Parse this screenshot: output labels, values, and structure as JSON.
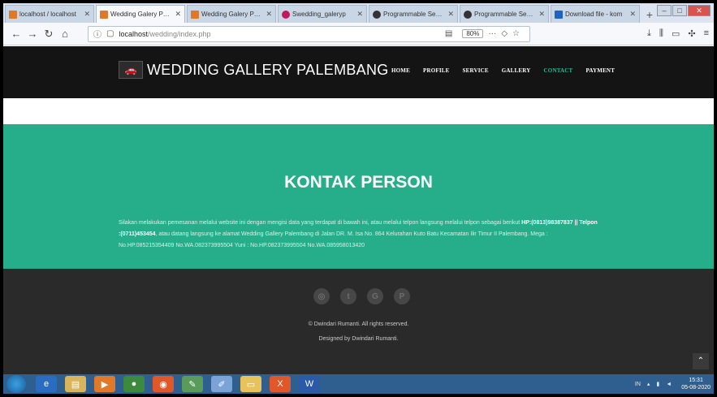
{
  "browser": {
    "tabs": [
      {
        "label": "localhost / localhost",
        "color": "#e0782a",
        "active": false
      },
      {
        "label": "Wedding Galery Palembang",
        "color": "#e0782a",
        "active": true
      },
      {
        "label": "Wedding Galery Palembang",
        "color": "#e0782a",
        "active": false
      },
      {
        "label": "Swedding_galeryp",
        "color": "#c2185b",
        "active": false
      },
      {
        "label": "Programmable Search",
        "color": "#333333",
        "active": false
      },
      {
        "label": "Programmable Search",
        "color": "#333333",
        "active": false
      },
      {
        "label": "Download file - kom",
        "color": "#1e63c4",
        "active": false
      }
    ],
    "url_host": "localhost",
    "url_path": "/wedding/index.php",
    "zoom": "80%"
  },
  "site": {
    "brand": "WEDDING GALLERY PALEMBANG",
    "menu": [
      {
        "label": "HOME",
        "active": false
      },
      {
        "label": "PROFILE",
        "active": false
      },
      {
        "label": "SERVICE",
        "active": false
      },
      {
        "label": "GALLERY",
        "active": false
      },
      {
        "label": "CONTACT",
        "active": true
      },
      {
        "label": "PAYMENT",
        "active": false
      }
    ],
    "accent": "#26ad8a",
    "contact": {
      "title": "KONTAK PERSON",
      "text_1": "Silakan melakukan pemesanan melalui website ini dengan mengisi data yang terdapat di bawah ini, atau melalui telpon langsung melalui telpon sebagai berikut",
      "phone_bold": "HP:(0813)98387837 || Telpon :(0711)453454",
      "text_2": ", atau datang langsung ke alamat Wedding Gallery Palembang di Jalan DR. M. Isa No. 864 Kelurahan Kuto Batu Kecamatan Ilir Timur II Palembang. Mega : No.HP.085215354409 No.WA.082373995504 Yuni : No.HP.082373995504 No.WA.085958013420"
    },
    "footer": {
      "social_icons": [
        "instagram-icon",
        "twitter-icon",
        "google-plus-icon",
        "pinterest-icon"
      ],
      "copyright": "© Dwindari Rumanti. All rights reserved.",
      "designed": "Designed by Dwindari Rumanti."
    }
  },
  "taskbar": {
    "clock_time": "15:31",
    "clock_date": "05-08-2020",
    "tray_lang": "IN"
  }
}
